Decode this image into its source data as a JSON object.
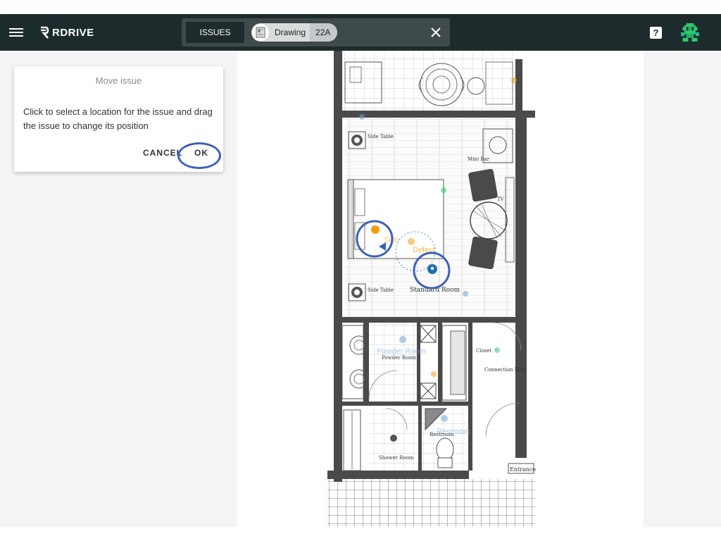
{
  "header": {
    "logo_text": "RDRIVE",
    "issues_tab": "ISSUES",
    "filter_chip": {
      "label": "Drawing",
      "value": "22A"
    }
  },
  "dialog": {
    "title": "Move issue",
    "body": "Click to select a location for the issue and drag the issue to change its position",
    "cancel_label": "CANCEL",
    "ok_label": "OK"
  },
  "plan": {
    "rooms": {
      "side_table_top": "Side Table",
      "side_table_bottom": "Side Table",
      "mini_bar": "Mini Bar",
      "tv": "TV",
      "standard_room": "Standard Room",
      "powder_room": "Powder Room",
      "closet": "Closet",
      "connection_door": "Connection Door",
      "shower_room": "Shower Room",
      "restroom": "Restroom",
      "entrance": "Entrance"
    },
    "overlay_labels": {
      "defect": "Defect",
      "powder_room": "Powder Room",
      "restroom": "Restroom",
      "side": "Side"
    }
  },
  "colors": {
    "topbar": "#1e2b2d",
    "accent_blue": "#3b62b5",
    "pin_orange": "#f39c12",
    "pin_blue": "#1f6fb0",
    "pin_green": "#2ecc71"
  }
}
